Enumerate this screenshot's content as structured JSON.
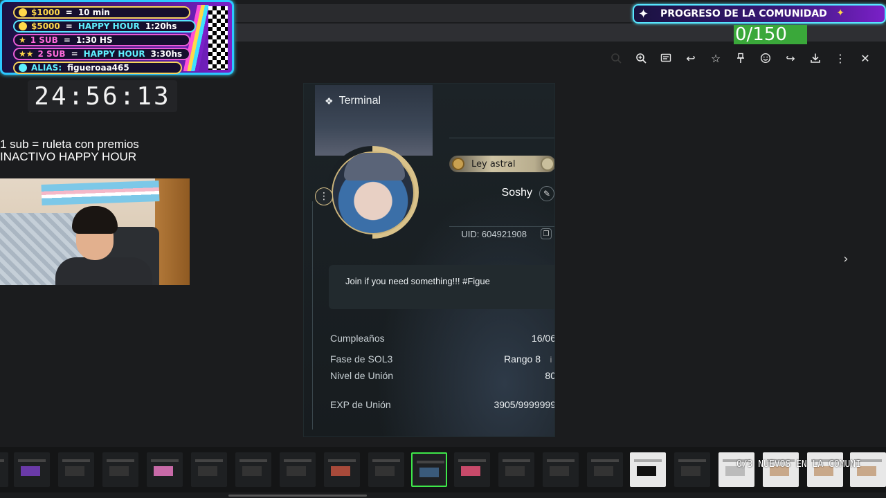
{
  "overlay": {
    "donations": [
      {
        "amount": "$1000",
        "eq": "=",
        "reward": "10 min"
      },
      {
        "amount": "$5000",
        "eq": "=",
        "reward_hh": "HAPPY HOUR",
        "reward": "1:20hs"
      },
      {
        "amount": "1 SUB",
        "eq": "=",
        "reward": "1:30 HS"
      },
      {
        "amount": "2 SUB",
        "eq": "=",
        "reward_hh": "HAPPY HOUR",
        "reward": "3:30hs"
      },
      {
        "amount": "ALIAS:",
        "reward": "figueroaa465"
      }
    ],
    "timer": "24:56:13",
    "sub_line1": "1 sub = ruleta con premios",
    "sub_line2": "INACTIVO HAPPY HOUR",
    "community_title": "PROGRESO DE LA COMUNIDAD",
    "community_count": "0/150",
    "new_community": "0/3 NUEVOS EN LA COMUNI"
  },
  "toolbar": {
    "icons": [
      "search-dim-icon",
      "zoom-in-icon",
      "caption-icon",
      "reply-icon",
      "star-icon",
      "pin-icon",
      "emoji-icon",
      "forward-icon",
      "download-icon",
      "more-icon",
      "close-icon"
    ],
    "glyphs": {
      "zoom": "⊕",
      "caption": "▤",
      "reply": "↩",
      "star": "☆",
      "pin": "⊥",
      "emoji": "☺",
      "forward": "↪",
      "download": "⤓",
      "more": "⋮",
      "close": "✕",
      "next": "›"
    }
  },
  "card": {
    "title": "Terminal",
    "badge": "Ley astral",
    "name": "Soshy",
    "uid": "UID: 604921908",
    "signature": "Join if you need something!!! #Figue",
    "stats": [
      {
        "label": "Cumpleaños",
        "value": "16/06"
      },
      {
        "label": "Fase de SOL3",
        "value": "Rango 8"
      },
      {
        "label": "Nivel de Unión",
        "value": "80"
      },
      {
        "label": "EXP de Unión",
        "value": "3905/9999999"
      }
    ]
  },
  "colors": {
    "accent_cyan": "#2cc8ff",
    "accent_gold": "#ffd84a",
    "progress_green": "#3aa83a",
    "thumb_selected": "#3ee84a"
  }
}
